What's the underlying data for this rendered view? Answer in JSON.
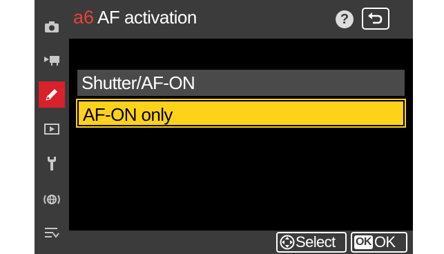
{
  "header": {
    "page_code": "a6",
    "title": "AF activation",
    "help_symbol": "?"
  },
  "sidebar": {
    "items": [
      {
        "name": "camera-icon",
        "active": false
      },
      {
        "name": "movie-icon",
        "active": false
      },
      {
        "name": "pencil-icon",
        "active": true
      },
      {
        "name": "playback-icon",
        "active": false
      },
      {
        "name": "wrench-icon",
        "active": false
      },
      {
        "name": "network-icon",
        "active": false
      },
      {
        "name": "my-menu-icon",
        "active": false
      }
    ]
  },
  "options": [
    {
      "label": "Shutter/AF-ON",
      "selected": false
    },
    {
      "label": "AF-ON only",
      "selected": true
    }
  ],
  "footer": {
    "select_label": "Select",
    "ok_chip": "OK",
    "ok_label": "OK"
  },
  "colors": {
    "accent": "#d8212b",
    "highlight": "#ffd21a",
    "panel": "#3b3b3b",
    "page_code": "#e8423a"
  }
}
